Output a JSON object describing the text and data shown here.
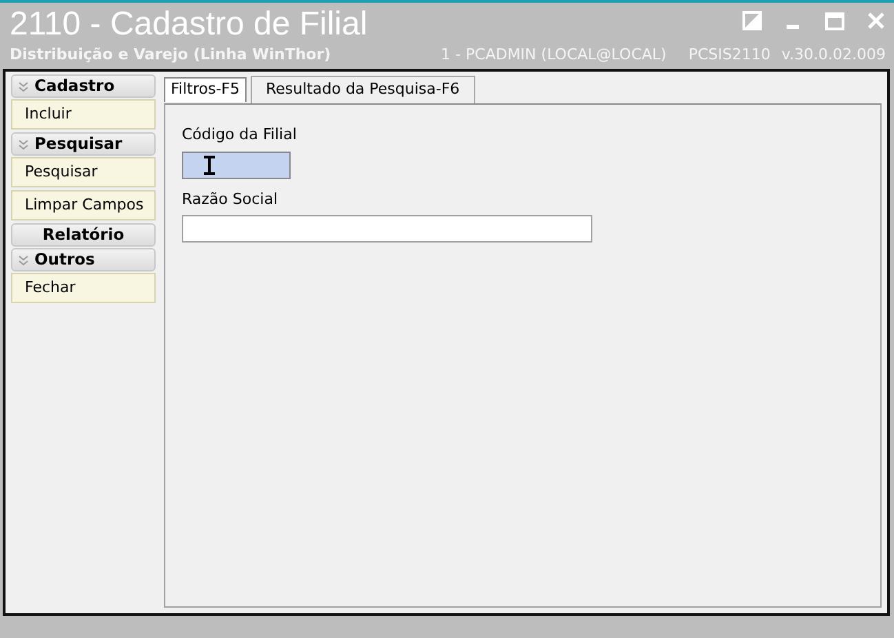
{
  "window": {
    "title": "2110 - Cadastro de Filial",
    "subtitle": "Distribuição e Varejo (Linha WinThor)",
    "user": "1 - PCADMIN (LOCAL@LOCAL)",
    "program": "PCSIS2110",
    "version": "v.30.0.02.009"
  },
  "sidebar": {
    "groups": [
      {
        "title": "Cadastro",
        "expanded": true,
        "items": [
          "Incluir"
        ]
      },
      {
        "title": "Pesquisar",
        "expanded": true,
        "items": [
          "Pesquisar",
          "Limpar Campos"
        ]
      },
      {
        "title": "Relatório",
        "expanded": false
      },
      {
        "title": "Outros",
        "expanded": true,
        "items": [
          "Fechar"
        ]
      }
    ]
  },
  "tabs": [
    {
      "label": "Filtros-F5",
      "selected": true
    },
    {
      "label": "Resultado da Pesquisa-F6",
      "selected": false
    }
  ],
  "fields": [
    {
      "label": "Código da Filial",
      "focused": true,
      "kind": "short"
    },
    {
      "label": "Razão Social",
      "focused": false,
      "kind": "long"
    }
  ]
}
